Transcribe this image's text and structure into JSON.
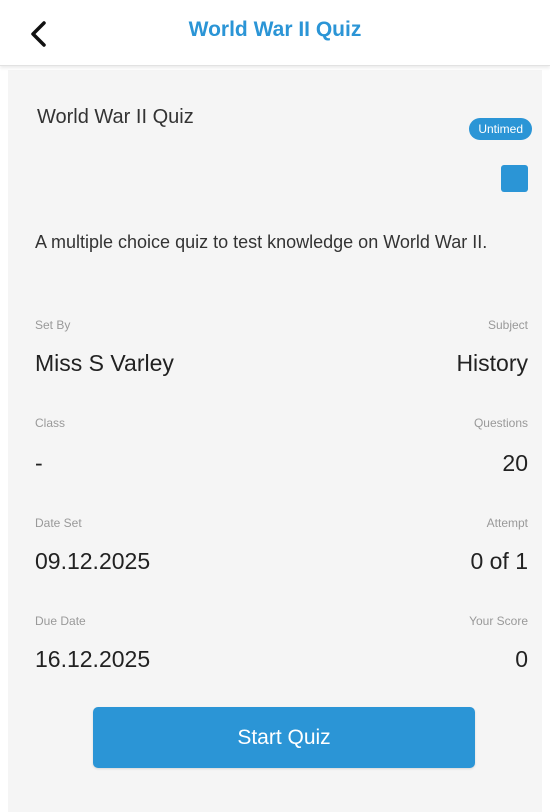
{
  "header": {
    "title": "World War II Quiz",
    "back_icon": "chevron-left-icon"
  },
  "quiz": {
    "name": "World War II Quiz",
    "badge": "Untimed",
    "swatch_color": "#2b95d6",
    "description": "A multiple choice quiz to test knowledge on World War II."
  },
  "info": {
    "set_by": {
      "label": "Set By",
      "value": "Miss S Varley"
    },
    "subject": {
      "label": "Subject",
      "value": "History"
    },
    "class": {
      "label": "Class",
      "value": "-"
    },
    "questions": {
      "label": "Questions",
      "value": "20"
    },
    "date_set": {
      "label": "Date Set",
      "value": "09.12.2025"
    },
    "attempt": {
      "label": "Attempt",
      "value": "0 of 1"
    },
    "due_date": {
      "label": "Due Date",
      "value": "16.12.2025"
    },
    "your_score": {
      "label": "Your Score",
      "value": "0"
    }
  },
  "actions": {
    "start_label": "Start Quiz"
  },
  "colors": {
    "accent": "#2b95d6",
    "card_background": "#f5f5f5"
  }
}
